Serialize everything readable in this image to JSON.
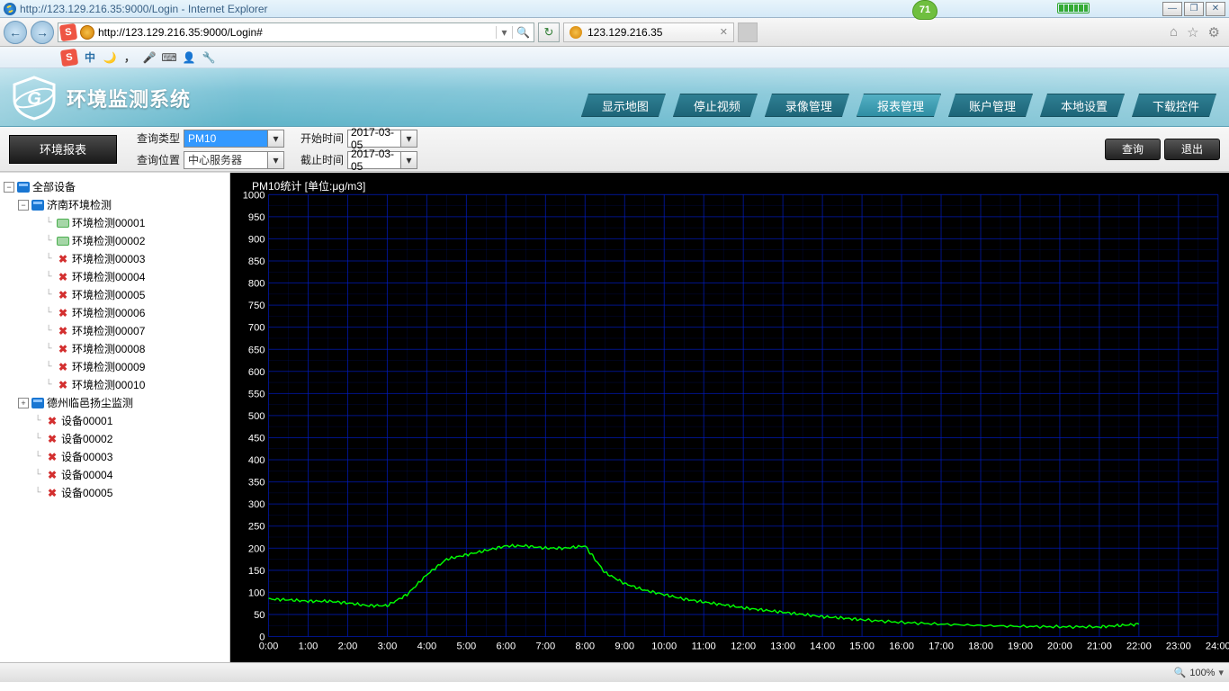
{
  "window": {
    "title": "http://123.129.216.35:9000/Login - Internet Explorer",
    "badge": "71"
  },
  "nav": {
    "url": "http://123.129.216.35:9000/Login#",
    "tab_label": "123.129.216.35"
  },
  "app": {
    "title": "环境监测系统"
  },
  "menu": [
    "显示地图",
    "停止视频",
    "录像管理",
    "报表管理",
    "账户管理",
    "本地设置",
    "下载控件"
  ],
  "query": {
    "tab": "环境报表",
    "type_label": "查询类型",
    "type_value": "PM10",
    "loc_label": "查询位置",
    "loc_value": "中心服务器",
    "start_label": "开始时间",
    "start_value": "2017-03-05",
    "end_label": "截止时间",
    "end_value": "2017-03-05",
    "search": "查询",
    "exit": "退出"
  },
  "tree": {
    "root": "全部设备",
    "group1": "济南环境检测",
    "g1_items": [
      {
        "label": "环境检测00001",
        "status": "ok"
      },
      {
        "label": "环境检测00002",
        "status": "ok"
      },
      {
        "label": "环境检测00003",
        "status": "err"
      },
      {
        "label": "环境检测00004",
        "status": "err"
      },
      {
        "label": "环境检测00005",
        "status": "err"
      },
      {
        "label": "环境检测00006",
        "status": "err"
      },
      {
        "label": "环境检测00007",
        "status": "err"
      },
      {
        "label": "环境检测00008",
        "status": "err"
      },
      {
        "label": "环境检测00009",
        "status": "err"
      },
      {
        "label": "环境检测00010",
        "status": "err"
      }
    ],
    "group2": "德州临邑扬尘监测",
    "orphans": [
      {
        "label": "设备00001",
        "status": "err"
      },
      {
        "label": "设备00002",
        "status": "err"
      },
      {
        "label": "设备00003",
        "status": "err"
      },
      {
        "label": "设备00004",
        "status": "err"
      },
      {
        "label": "设备00005",
        "status": "err"
      }
    ]
  },
  "chart_title": "PM10统计   [单位:μg/m3]",
  "chart_data": {
    "type": "line",
    "title": "PM10统计   [单位:μg/m3]",
    "xlabel": "",
    "ylabel": "",
    "ylim": [
      0,
      1000
    ],
    "xlim_hours": [
      0,
      24
    ],
    "x_ticks": [
      "0:00",
      "1:00",
      "2:00",
      "3:00",
      "4:00",
      "5:00",
      "6:00",
      "7:00",
      "8:00",
      "9:00",
      "10:00",
      "11:00",
      "12:00",
      "13:00",
      "14:00",
      "15:00",
      "16:00",
      "17:00",
      "18:00",
      "19:00",
      "20:00",
      "21:00",
      "22:00",
      "23:00",
      "24:00"
    ],
    "y_ticks": [
      0,
      50,
      100,
      150,
      200,
      250,
      300,
      350,
      400,
      450,
      500,
      550,
      600,
      650,
      700,
      750,
      800,
      850,
      900,
      950,
      1000
    ],
    "series": [
      {
        "name": "PM10",
        "color": "#00ff00",
        "x": [
          0.0,
          0.5,
          1.0,
          1.5,
          2.0,
          2.5,
          3.0,
          3.5,
          4.0,
          4.5,
          5.0,
          5.5,
          6.0,
          6.5,
          7.0,
          7.5,
          8.0,
          8.25,
          8.5,
          9.0,
          9.5,
          10.0,
          10.5,
          11.0,
          11.5,
          12.0,
          12.5,
          13.0,
          13.5,
          14.0,
          14.5,
          15.0,
          16.0,
          17.0,
          18.0,
          19.0,
          20.0,
          21.0,
          21.5,
          22.0
        ],
        "y": [
          85,
          83,
          80,
          80,
          76,
          70,
          70,
          95,
          140,
          175,
          185,
          195,
          205,
          205,
          200,
          200,
          205,
          175,
          145,
          120,
          105,
          95,
          85,
          78,
          72,
          65,
          60,
          55,
          50,
          45,
          42,
          38,
          32,
          28,
          25,
          23,
          22,
          22,
          25,
          28
        ]
      }
    ],
    "data_extent_hours": 22.0
  },
  "status": {
    "zoom": "100%"
  }
}
